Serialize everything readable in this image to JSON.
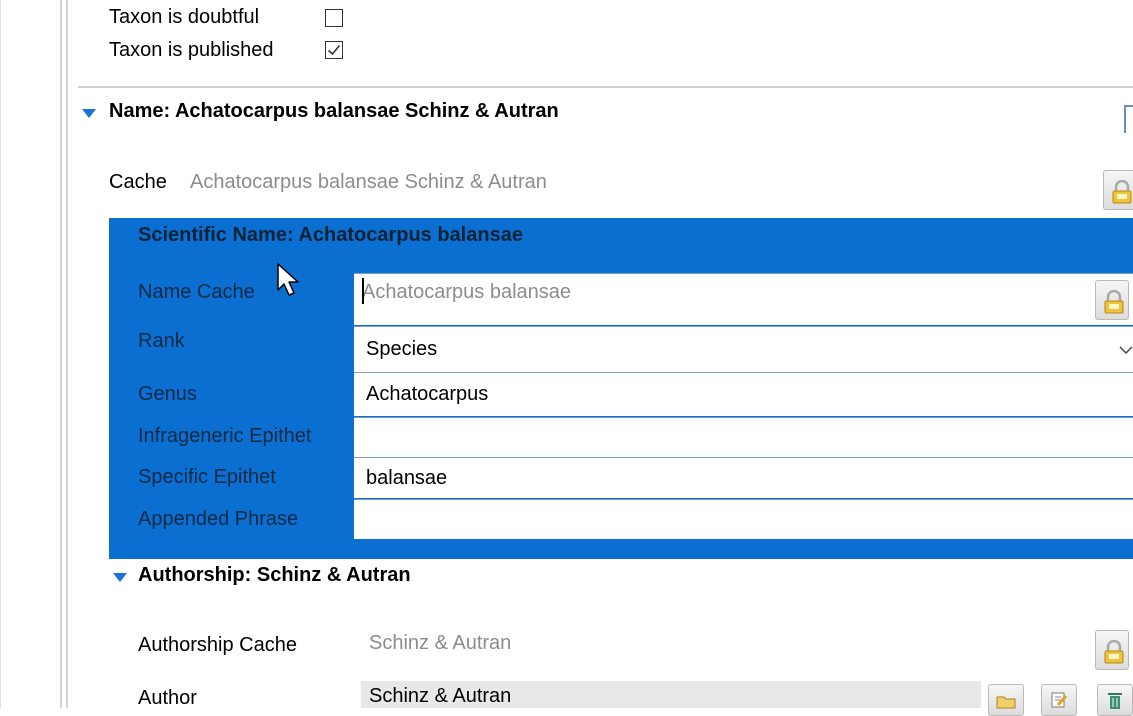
{
  "taxon": {
    "doubtful_label": "Taxon is doubtful",
    "doubtful_checked": false,
    "published_label": "Taxon is published",
    "published_checked": true
  },
  "name_section": {
    "title": "Name: Achatocarpus balansae Schinz & Autran",
    "cache_label": "Cache",
    "cache_value": "Achatocarpus balansae Schinz & Autran"
  },
  "scientific_name": {
    "title": "Scientific Name: Achatocarpus balansae",
    "fields": {
      "name_cache": {
        "label": "Name Cache",
        "value": "Achatocarpus balansae"
      },
      "rank": {
        "label": "Rank",
        "value": "Species"
      },
      "genus": {
        "label": "Genus",
        "value": "Achatocarpus"
      },
      "infrageneric_epithet": {
        "label": "Infrageneric Epithet",
        "value": ""
      },
      "specific_epithet": {
        "label": "Specific Epithet",
        "value": "balansae"
      },
      "appended_phrase": {
        "label": "Appended Phrase",
        "value": ""
      }
    }
  },
  "authorship": {
    "title": "Authorship: Schinz & Autran",
    "cache_label": "Authorship Cache",
    "cache_value": "Schinz & Autran",
    "author_label": "Author",
    "author_value": "Schinz & Autran"
  },
  "colors": {
    "selection_blue": "#0a6fd1",
    "section_triangle": "#1a73d6",
    "grey_text": "#8c8c8c"
  },
  "icons": [
    "lock-icon",
    "expand-triangle-icon",
    "chevron-down-icon",
    "mouse-cursor-icon",
    "folder-icon",
    "edit-icon",
    "trash-icon",
    "checkmark-icon"
  ]
}
